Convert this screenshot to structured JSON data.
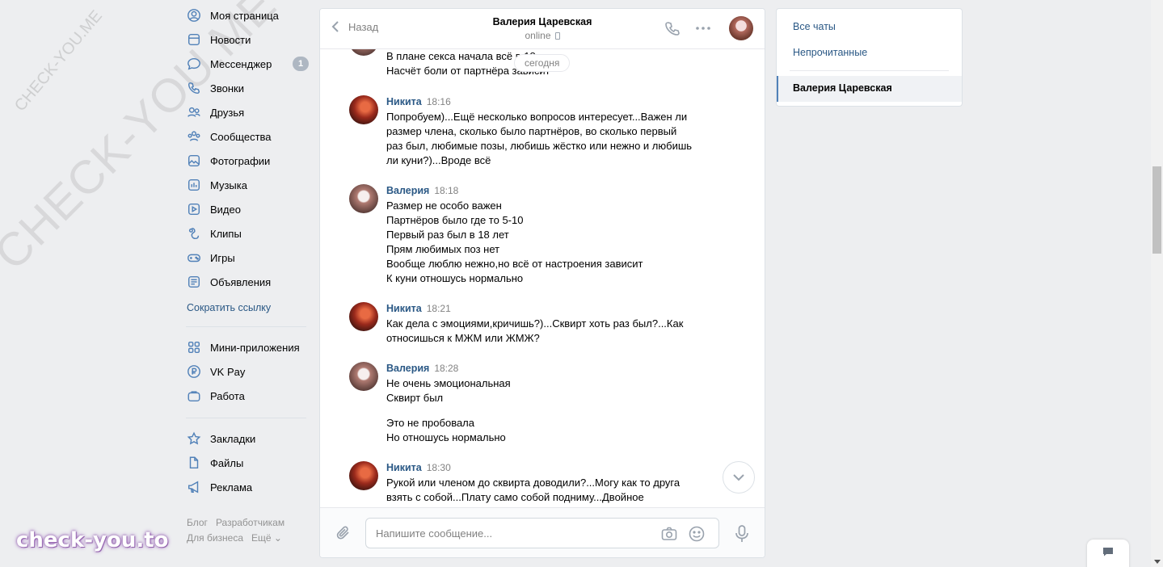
{
  "nav": {
    "items": [
      {
        "label": "Моя страница",
        "icon": "user-circle-icon"
      },
      {
        "label": "Новости",
        "icon": "news-icon"
      },
      {
        "label": "Мессенджер",
        "icon": "message-icon",
        "badge": "1"
      },
      {
        "label": "Звонки",
        "icon": "phone-icon"
      },
      {
        "label": "Друзья",
        "icon": "friends-icon"
      },
      {
        "label": "Сообщества",
        "icon": "communities-icon"
      },
      {
        "label": "Фотографии",
        "icon": "photo-icon"
      },
      {
        "label": "Музыка",
        "icon": "music-icon"
      },
      {
        "label": "Видео",
        "icon": "video-icon"
      },
      {
        "label": "Клипы",
        "icon": "clips-icon"
      },
      {
        "label": "Игры",
        "icon": "gamepad-icon"
      },
      {
        "label": "Объявления",
        "icon": "ads-list-icon"
      }
    ],
    "short_link": "Сократить ссылку",
    "items2": [
      {
        "label": "Мини-приложения",
        "icon": "apps-grid-icon"
      },
      {
        "label": "VK Pay",
        "icon": "vk-pay-icon"
      },
      {
        "label": "Работа",
        "icon": "briefcase-icon"
      }
    ],
    "items3": [
      {
        "label": "Закладки",
        "icon": "star-icon"
      },
      {
        "label": "Файлы",
        "icon": "file-icon"
      },
      {
        "label": "Реклама",
        "icon": "megaphone-icon"
      }
    ],
    "footer": {
      "blog": "Блог",
      "devs": "Разработчикам",
      "business": "Для бизнеса",
      "more": "Ещё ⌄"
    }
  },
  "chat": {
    "back_label": "Назад",
    "peer_name": "Валерия Царевская",
    "peer_status": "online",
    "date_label": "сегодня",
    "partial_lines": [
      "В плане секса начала всё          в 18",
      "Насчёт боли от партнёра зависит"
    ],
    "messages": [
      {
        "author": "Никита",
        "time": "18:16",
        "avatar": "nikita",
        "lines": [
          "Попробуем)...Ещё несколько вопросов интересует...Важен ли",
          "размер члена, сколько было партнёров, во сколько первый",
          "раз был, любимые позы, любишь жёстко или нежно и любишь",
          "ли куни?)...Вроде всё"
        ]
      },
      {
        "author": "Валерия",
        "time": "18:18",
        "avatar": "valeria",
        "lines": [
          "Размер не особо важен",
          "Партнёров было где то 5-10",
          "Первый раз был в 18 лет",
          "Прям любимых поз нет",
          "Вообще люблю нежно,но всё от настроения зависит",
          "К куни отношусь нормально"
        ]
      },
      {
        "author": "Никита",
        "time": "18:21",
        "avatar": "nikita",
        "lines": [
          "Как дела с эмоциями,кричишь?)...Сквирт хоть раз был?...Как",
          "относишься к МЖМ или ЖМЖ?"
        ]
      },
      {
        "author": "Валерия",
        "time": "18:28",
        "avatar": "valeria",
        "lines": [
          "Не очень эмоциональная",
          "Сквирт был"
        ],
        "lines2": [
          "Это не пробовала",
          "Но отношусь нормально"
        ]
      },
      {
        "author": "Никита",
        "time": "18:30",
        "avatar": "nikita",
        "lines": [
          "Рукой или членом до сквирта доводили?...Могу как то друга",
          "взять с собой...Плату само собой подниму...Двойное"
        ]
      }
    ],
    "composer_placeholder": "Напишите сообщение..."
  },
  "right": {
    "all_chats": "Все чаты",
    "unread": "Непрочитанные",
    "active_chat": "Валерия Царевская"
  },
  "watermarks": {
    "small": "CHECK-YOU.ME",
    "large": "CHECK-YOU.ME",
    "brand": "check-you.to"
  }
}
